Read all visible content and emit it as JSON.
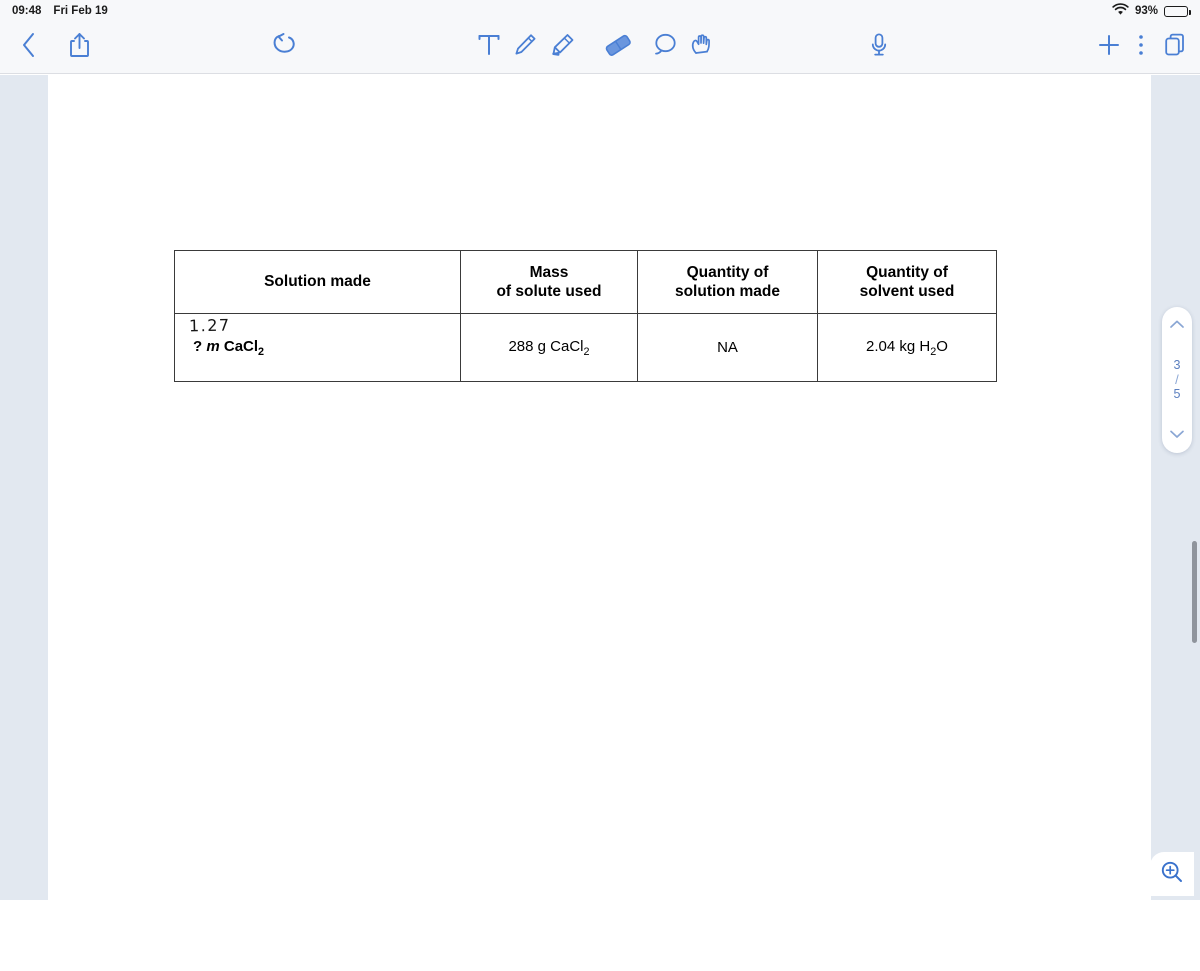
{
  "status_bar": {
    "time": "09:48",
    "date": "Fri Feb 19",
    "battery_percent": "93%",
    "wifi_icon": "wifi-icon",
    "battery_icon": "battery-icon"
  },
  "toolbar": {
    "back_icon": "chevron-left-icon",
    "share_icon": "share-icon",
    "undo_icon": "undo-icon",
    "text_tool_icon": "text-tool-icon",
    "pen_tool_icon": "pen-tool-icon",
    "highlighter_tool_icon": "highlighter-tool-icon",
    "eraser_tool_icon": "eraser-tool-icon",
    "lasso_tool_icon": "lasso-tool-icon",
    "hand_tool_icon": "hand-tool-icon",
    "microphone_icon": "microphone-icon",
    "add_icon": "plus-icon",
    "more_icon": "more-vertical-icon",
    "pages_icon": "pages-icon",
    "accent_color": "#4a7fd4",
    "active_tool": "eraser"
  },
  "document": {
    "table": {
      "headers": [
        "Solution made",
        {
          "line1": "Mass",
          "line2": "of solute used"
        },
        {
          "line1": "Quantity of",
          "line2": "solution made"
        },
        {
          "line1": "Quantity of",
          "line2": "solvent used"
        }
      ],
      "rows": [
        {
          "handwritten_note": "1.27",
          "solution_made_prefix": "? ",
          "solution_made_italic": "m",
          "solution_made_formula": "CaCl",
          "solution_made_sub": "2",
          "mass_of_solute_value": "288 g CaCl",
          "mass_of_solute_sub": "2",
          "quantity_of_solution": "NA",
          "quantity_of_solvent_value": "2.04 kg H",
          "quantity_of_solvent_sub": "2",
          "quantity_of_solvent_suffix": "O"
        }
      ]
    }
  },
  "page_navigator": {
    "up_icon": "chevron-up-icon",
    "down_icon": "chevron-down-icon",
    "current_page": "3",
    "separator": "/",
    "total_pages": "5"
  },
  "zoom_control": {
    "icon": "zoom-in-icon"
  }
}
